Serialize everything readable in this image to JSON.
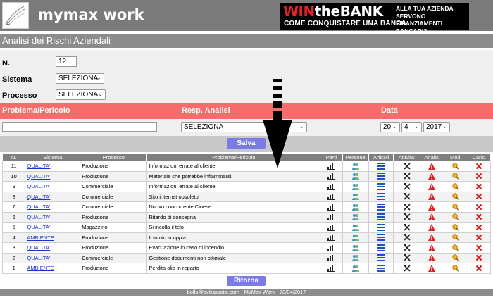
{
  "header": {
    "app_title": "mymax work",
    "banner": {
      "win": "WIN",
      "the_bank": "theBANK",
      "subtitle": "COME CONQUISTARE UNA BANCA",
      "right_text": "ALLA TUA AZIENDA SERVONO FINANZIAMENTI BANCARI?"
    }
  },
  "page_title": "Analisi dei Rischi Aziendali",
  "form": {
    "n_label": "N.",
    "n_value": "12",
    "sistema_label": "Sistema",
    "sistema_value": "SELEZIONA",
    "processo_label": "Processo",
    "processo_value": "SELEZIONA"
  },
  "filters": {
    "problema_label": "Problema/Pericolo",
    "resp_label": "Resp. Analisi",
    "data_label": "Data",
    "resp_value": "SELEZIONA",
    "day": "20",
    "month": "4",
    "year": "2017"
  },
  "buttons": {
    "salva": "Salva",
    "ritorna": "Ritorna"
  },
  "table": {
    "headers": [
      "N.",
      "Sistema",
      "Processo",
      "Problema/Pericolo",
      "Parti",
      "Persone",
      "Articoli",
      "Attivita'",
      "Analisi",
      "Mod.",
      "Canc."
    ],
    "rows": [
      {
        "n": "11",
        "sistema": "QUALITA'",
        "processo": "Produzione",
        "problema": "Informazioni errate al cliente"
      },
      {
        "n": "10",
        "sistema": "QUALITA'",
        "processo": "Produzione",
        "problema": "Materiale che potrebbe infiammarsi"
      },
      {
        "n": "9",
        "sistema": "QUALITA'",
        "processo": "Commerciale",
        "problema": "Informazioni errate al cliente"
      },
      {
        "n": "8",
        "sistema": "QUALITA'",
        "processo": "Commerciale",
        "problema": "Sito internet obsoleto"
      },
      {
        "n": "7",
        "sistema": "QUALITA'",
        "processo": "Commerciale",
        "problema": "Nuovo concorrente Cinese"
      },
      {
        "n": "6",
        "sistema": "QUALITA'",
        "processo": "Produzione",
        "problema": "Ritardo di consegna"
      },
      {
        "n": "5",
        "sistema": "QUALITA'",
        "processo": "Magazzino",
        "problema": "Si incolla il telo"
      },
      {
        "n": "4",
        "sistema": "AMBIENTE",
        "processo": "Produzione",
        "problema": "Il tornio scoppia"
      },
      {
        "n": "3",
        "sistema": "QUALITA'",
        "processo": "Produzione",
        "problema": "Evacuazione in caso di incendio"
      },
      {
        "n": "2",
        "sistema": "QUALITA'",
        "processo": "Commerciale",
        "problema": "Gestione documenti non ottimale"
      },
      {
        "n": "1",
        "sistema": "AMBIENTE",
        "processo": "Produzione",
        "problema": "Perdita olio in reparto"
      }
    ]
  },
  "footer": "bolla@sviluppoisi.com - MyMax Work - 20/04/2017",
  "colors": {
    "topbar": "#7a7a7a",
    "accent_red": "#f76b6b",
    "button_blue": "#7b7be6",
    "link_blue": "#1a33cc"
  }
}
